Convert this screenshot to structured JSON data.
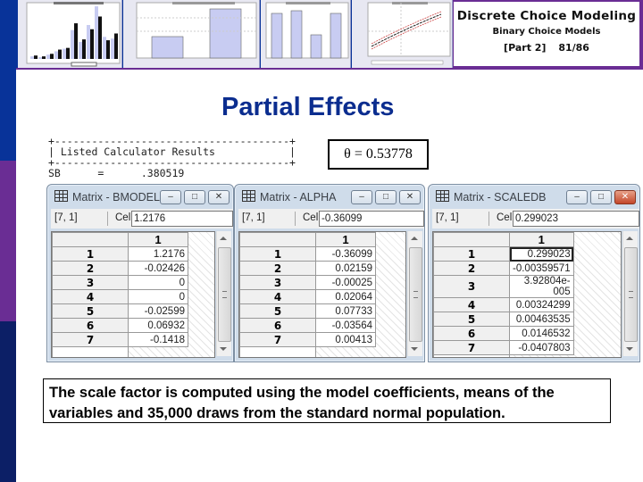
{
  "header": {
    "course_title": "Discrete Choice Modeling",
    "subtitle": "Binary Choice Models",
    "part": "[Part 2]",
    "page": "81/86"
  },
  "thumbnails": [
    {
      "kind": "grouped-bar-chart",
      "label": "histogram thumbnail"
    },
    {
      "kind": "bar-chart",
      "label": "two-bar chart thumbnail"
    },
    {
      "kind": "bar-chart",
      "label": "four-bar chart thumbnail"
    },
    {
      "kind": "line-chart",
      "label": "curve with confidence bands thumbnail"
    }
  ],
  "slide": {
    "heading": "Partial Effects",
    "calculator": {
      "border_top": "+--------------------------------------+",
      "title_line": "| Listed Calculator Results            |",
      "border_bottom": "+--------------------------------------+",
      "result_line": "SB      =      .380519"
    },
    "theta_box": "θ = 0.53778",
    "note": "The scale factor is computed using the model coefficients, means of the variables and 35,000 draws from the standard normal population."
  },
  "windows": [
    {
      "title": "Matrix - BMODEL",
      "position": "[7, 1]",
      "cell_label": "Cell:",
      "cell_value": "1.2176",
      "column_header": "1",
      "rows": [
        {
          "label": "1",
          "value": "1.2176"
        },
        {
          "label": "2",
          "value": "-0.02426"
        },
        {
          "label": "3",
          "value": "0"
        },
        {
          "label": "4",
          "value": "0"
        },
        {
          "label": "5",
          "value": "-0.02599"
        },
        {
          "label": "6",
          "value": "0.06932"
        },
        {
          "label": "7",
          "value": "-0.1418"
        }
      ]
    },
    {
      "title": "Matrix - ALPHA",
      "position": "[7, 1]",
      "cell_label": "Cell:",
      "cell_value": "-0.36099",
      "column_header": "1",
      "rows": [
        {
          "label": "1",
          "value": "-0.36099"
        },
        {
          "label": "2",
          "value": "0.02159"
        },
        {
          "label": "3",
          "value": "-0.00025"
        },
        {
          "label": "4",
          "value": "0.02064"
        },
        {
          "label": "5",
          "value": "0.07733"
        },
        {
          "label": "6",
          "value": "-0.03564"
        },
        {
          "label": "7",
          "value": "0.00413"
        }
      ]
    },
    {
      "title": "Matrix - SCALEDB",
      "position": "[7, 1]",
      "cell_label": "Cell:",
      "cell_value": "0.299023",
      "column_header": "1",
      "rows": [
        {
          "label": "1",
          "value": "0.299023"
        },
        {
          "label": "2",
          "value": "-0.00359571"
        },
        {
          "label": "3",
          "value": "3.92804e-005"
        },
        {
          "label": "4",
          "value": "0.00324299"
        },
        {
          "label": "5",
          "value": "0.00463535"
        },
        {
          "label": "6",
          "value": "0.0146532"
        },
        {
          "label": "7",
          "value": "-0.0407803"
        }
      ]
    }
  ],
  "window_buttons": {
    "minimize": "–",
    "maximize": "□",
    "close": "✕"
  },
  "colors": {
    "stripe_blue": "#083399",
    "stripe_purple": "#6a2d94",
    "stripe_navy": "#0c1f66",
    "heading_blue": "#0b2d8f"
  }
}
